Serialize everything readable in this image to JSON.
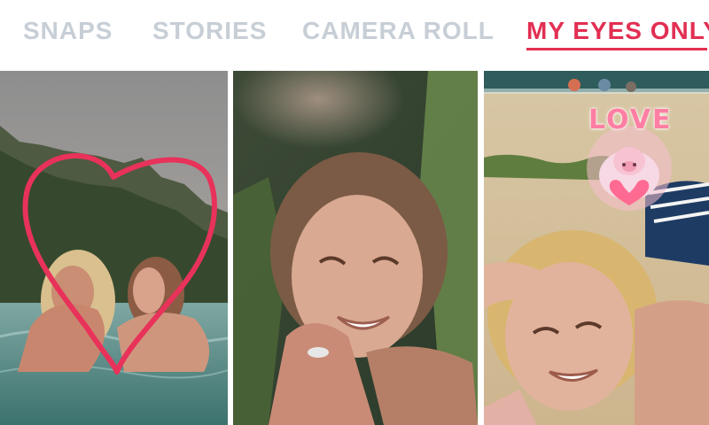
{
  "tabs": {
    "snaps": "SNAPS",
    "stories": "STORIES",
    "camera_roll": "CAMERA ROLL",
    "my_eyes_only": "MY EYES ONLY",
    "active": "my_eyes_only"
  },
  "memories": [
    {
      "description": "couple kissing in water with heart drawing",
      "drawing_color": "#e8325a"
    },
    {
      "description": "smiling woman in front of waterfall"
    },
    {
      "description": "two women laughing on beach",
      "sticker": "LOVE"
    }
  ],
  "colors": {
    "accent": "#e22f52",
    "inactive_tab": "#c7ced6",
    "sticker": "#ff7ea3"
  }
}
